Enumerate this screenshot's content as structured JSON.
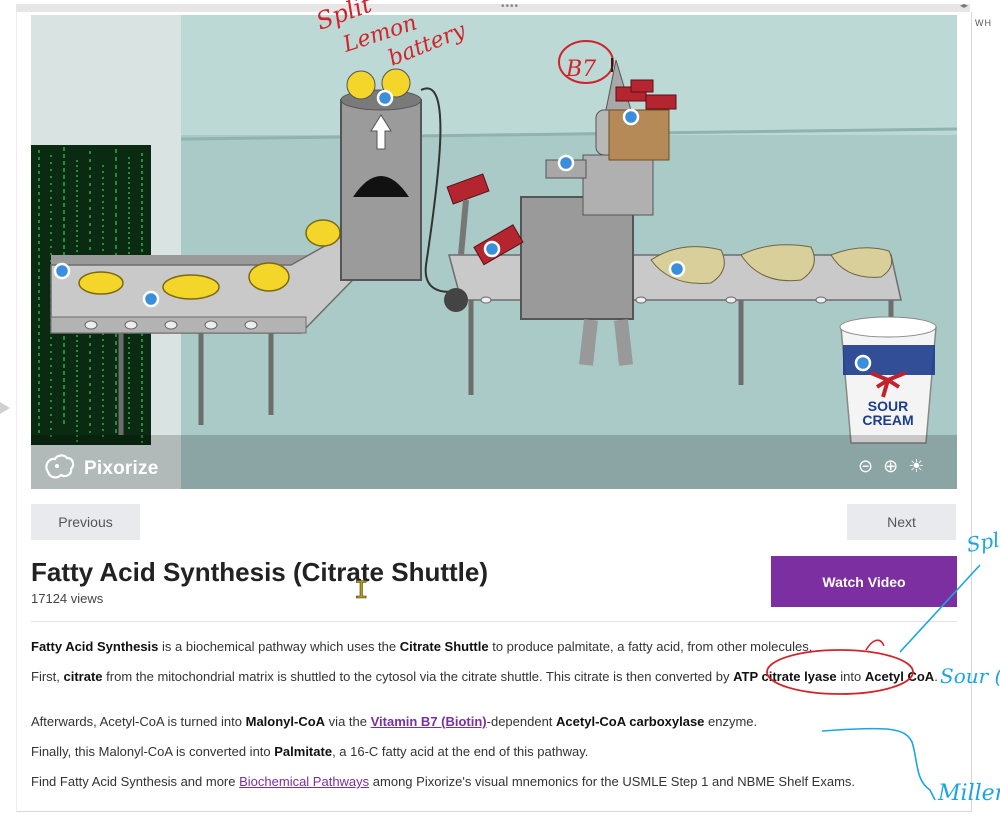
{
  "viewer": {
    "previous_label": "Previous",
    "next_label": "Next",
    "brand_name": "Pixorize",
    "sign_text": [
      "SOUR",
      "CREAM"
    ],
    "controls": [
      "reset-zoom-icon",
      "zoom-in-icon",
      "brightness-icon"
    ]
  },
  "page": {
    "title": "Fatty Acid Synthesis (Citrate Shuttle)",
    "views": "17124 views",
    "watch_video_label": "Watch Video"
  },
  "article": {
    "p1": {
      "s1": "Fatty Acid Synthesis",
      "t1": " is a biochemical pathway which uses the ",
      "s2": "Citrate Shuttle",
      "t2": " to produce palmitate, a fatty acid, from other molecules."
    },
    "p2": {
      "t0": "First, ",
      "s1": "citrate",
      "t1": " from the mitochondrial matrix is shuttled to the cytosol via the citrate shuttle. This citrate is then converted by ",
      "s2": "ATP citrate lyase",
      "t2": " into ",
      "s3": "Acetyl CoA",
      "t3": "."
    },
    "p3": {
      "t0": "Afterwards, Acetyl-CoA is turned into ",
      "s1": "Malonyl-CoA",
      "t1": " via the ",
      "link1": "Vitamin B7 (Biotin)",
      "t2": "-dependent ",
      "s2": "Acetyl-CoA carboxylase",
      "t3": " enzyme."
    },
    "p4": {
      "t0": "Finally, this Malonyl-CoA is converted into ",
      "s1": "Palmitate",
      "t1": ", a 16-C fatty acid at the end of this pathway."
    },
    "p5": {
      "t0": "Find Fatty Acid Synthesis and more ",
      "link1": "Biochemical Pathways",
      "t1": " among Pixorize's visual mnemonics for the USMLE Step 1 and NBME Shelf Exams."
    }
  },
  "annotations": {
    "red_top": [
      "Split",
      "Lemon",
      "battery"
    ],
    "red_b7": "B7",
    "blue_right": [
      "Spli",
      "Sour (",
      "Millen"
    ]
  },
  "right_panel": {
    "label": "WH"
  },
  "colors": {
    "accent": "#7b2fa1",
    "hotspot": "#3a8fdc",
    "annotation_red": "#d2232a",
    "annotation_blue": "#1aa6e0"
  }
}
